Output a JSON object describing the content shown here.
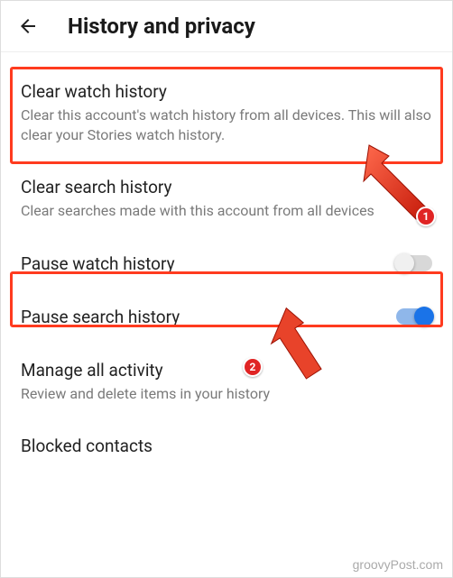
{
  "header": {
    "title": "History and privacy"
  },
  "items": {
    "clear_watch": {
      "title": "Clear watch history",
      "desc": "Clear this account's watch history from all devices. This will also clear your Stories watch history."
    },
    "clear_search": {
      "title": "Clear search history",
      "desc": "Clear searches made with this account from all devices"
    },
    "pause_watch": {
      "title": "Pause watch history",
      "toggle": "off"
    },
    "pause_search": {
      "title": "Pause search history",
      "toggle": "on"
    },
    "manage": {
      "title": "Manage all activity",
      "desc": "Review and delete items in your history"
    },
    "blocked": {
      "title": "Blocked contacts"
    }
  },
  "annotations": {
    "badge1": "1",
    "badge2": "2"
  },
  "watermark": "groovyPost.com"
}
